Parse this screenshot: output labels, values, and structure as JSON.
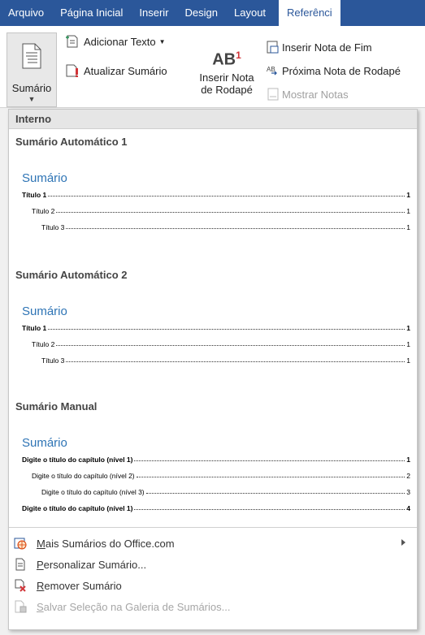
{
  "tabs": [
    "Arquivo",
    "Página Inicial",
    "Inserir",
    "Design",
    "Layout",
    "Referênci"
  ],
  "ribbon": {
    "sumario_label": "Sumário",
    "adicionar_texto": "Adicionar Texto",
    "atualizar_sumario": "Atualizar Sumário",
    "inserir_nota_line1": "Inserir Nota",
    "inserir_nota_line2": "de Rodapé",
    "ab_glyph": "AB",
    "ab_sup": "1",
    "inserir_nota_fim": "Inserir Nota de Fim",
    "proxima_nota": "Próxima Nota de Rodapé",
    "mostrar_notas": "Mostrar Notas"
  },
  "dropdown": {
    "section_header": "Interno",
    "galleries": [
      {
        "title": "Sumário Automático 1",
        "heading": "Sumário",
        "rows": [
          {
            "text": "Título 1",
            "page": "1",
            "level": 1,
            "bold": true
          },
          {
            "text": "Título 2",
            "page": "1",
            "level": 2,
            "bold": false
          },
          {
            "text": "Título 3",
            "page": "1",
            "level": 3,
            "bold": false
          }
        ]
      },
      {
        "title": "Sumário Automático 2",
        "heading": "Sumário",
        "rows": [
          {
            "text": "Título 1",
            "page": "1",
            "level": 1,
            "bold": true
          },
          {
            "text": "Título 2",
            "page": "1",
            "level": 2,
            "bold": false
          },
          {
            "text": "Título 3",
            "page": "1",
            "level": 3,
            "bold": false
          }
        ]
      },
      {
        "title": "Sumário Manual",
        "heading": "Sumário",
        "rows": [
          {
            "text": "Digite o título do capítulo (nível 1)",
            "page": "1",
            "level": 1,
            "bold": true
          },
          {
            "text": "Digite o título do capítulo (nível 2)",
            "page": "2",
            "level": 2,
            "bold": false
          },
          {
            "text": "Digite o título do capítulo (nível 3)",
            "page": "3",
            "level": 3,
            "bold": false
          },
          {
            "text": "Digite o título do capítulo (nível 1)",
            "page": "4",
            "level": 1,
            "bold": true
          }
        ]
      }
    ],
    "menu": [
      {
        "label": "Mais Sumários do Office.com",
        "accel": "M",
        "rest": "ais Sumários do Office.com",
        "icon": "office-globe-icon",
        "disabled": false,
        "submenu": true
      },
      {
        "label": "Personalizar Sumário...",
        "accel": "P",
        "rest": "ersonalizar Sumário...",
        "icon": "document-settings-icon",
        "disabled": false,
        "submenu": false
      },
      {
        "label": "Remover Sumário",
        "accel": "R",
        "rest": "emover Sumário",
        "icon": "remove-document-icon",
        "disabled": false,
        "submenu": false
      },
      {
        "label": "Salvar Seleção na Galeria de Sumários...",
        "accel": "S",
        "rest": "alvar Seleção na Galeria de Sumários...",
        "icon": "save-to-gallery-icon",
        "disabled": true,
        "submenu": false
      }
    ]
  },
  "colors": {
    "ribbon_blue": "#2b579a",
    "toc_heading": "#2e74b5",
    "remove_red": "#d13438"
  }
}
